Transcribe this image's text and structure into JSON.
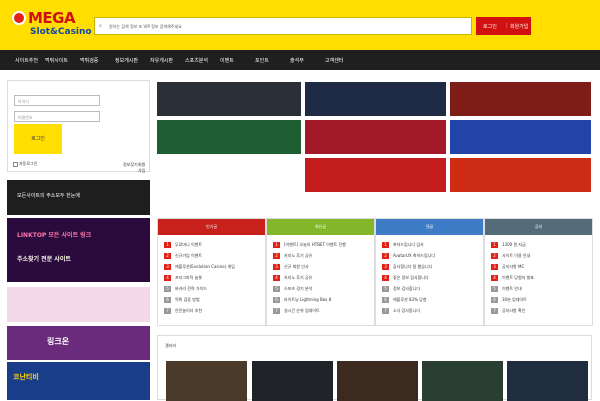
{
  "logo": {
    "top": "MEGA",
    "bottom": "Slot&Casino"
  },
  "search": {
    "text": "원하는 검색 정보 또 VIP 정보 검색해주세요"
  },
  "auth": {
    "login": "로그인",
    "signup": "회원가입"
  },
  "nav": [
    "사이트추천",
    "먹튀사이트",
    "먹튀검증",
    "정보게시판",
    "자유게시판",
    "스포츠분석",
    "이벤트",
    "포인트",
    "출석부",
    "고객센터"
  ],
  "login": {
    "id_placeholder": "아이디",
    "pw_placeholder": "비밀번호",
    "button": "로그인",
    "auto": "자동로그인",
    "find": "정보찾기",
    "join": "회원가입"
  },
  "sidebar_banners": [
    "모든사이트의 주소모두 한눈에",
    "LINKTOP 모든 사이트 링크",
    "주소찾기 전문 사이트",
    "링크온",
    "코난티비"
  ],
  "popular": [
    {
      "title": "인기글",
      "color": "#c8211c",
      "items": [
        "무료머니 이벤트",
        "신규가입 이벤트",
        "에볼루션(Evolution Casino) 게임",
        "프라그마틱 슬롯",
        "바카라 전략 가이드",
        "먹튀 검증 방법",
        "안전놀이터 추천"
      ]
    },
    {
      "title": "최신글",
      "color": "#83b629",
      "items": [
        "[이벤트] 오늘의 HTBET 이벤트 진행",
        "카지노 후기 공유",
        "신규 회원 인사",
        "카지노 후기 공유",
        "스포츠 경기 분석",
        "라이트닝 Lightning Box 8",
        "실시간 순위 업데이트"
      ]
    },
    {
      "title": "댓글",
      "color": "#3e7cc7",
      "items": [
        "축하드립니다 감사",
        "AvatarUX 축하드립니다",
        "감사합니다 잘 봤습니다",
        "좋은 정보 감사합니다",
        "정보 감사합니다",
        "에볼루션 83% 당첨",
        "소식 감사합니다"
      ]
    },
    {
      "title": "공지",
      "color": "#556b7a",
      "items": [
        "1300 원 지급",
        "사이트 이용 안내",
        "공지사항 MC",
        "이벤트 당첨자 발표",
        "이벤트 안내",
        "30분 업데이트",
        "공지사항 확인"
      ]
    }
  ],
  "gallery": {
    "title": "갤러리"
  }
}
